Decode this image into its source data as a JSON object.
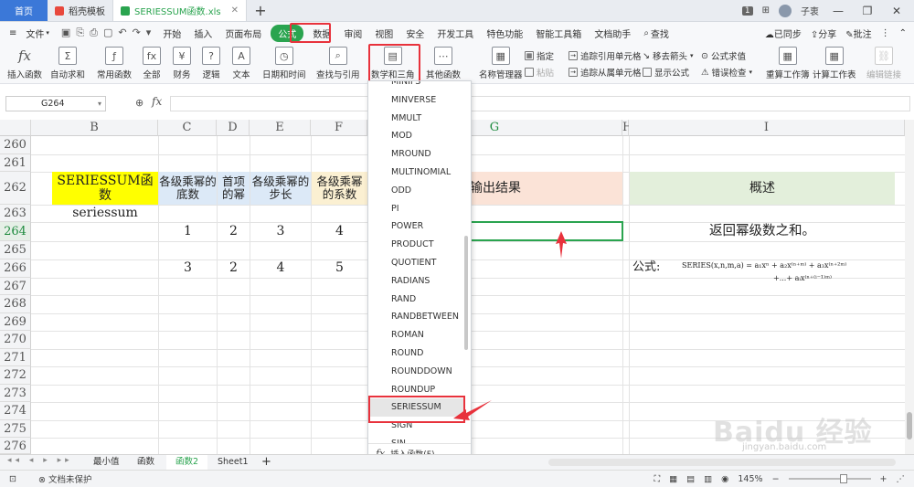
{
  "titlebar": {
    "home_tab": "首页",
    "template_tab": "稻壳模板",
    "file_tab": "SERIESSUM函数.xls",
    "page_badge": "1",
    "username": "子衷"
  },
  "menubar": {
    "file": "文件",
    "items": [
      "开始",
      "插入",
      "页面布局",
      "公式",
      "数据",
      "审阅",
      "视图",
      "安全",
      "开发工具",
      "特色功能",
      "智能工具箱",
      "文档助手"
    ],
    "search": "查找",
    "synced": "已同步",
    "share": "分享",
    "annotate": "批注"
  },
  "ribbon": {
    "insert_function": "插入函数",
    "autosum": "自动求和",
    "common_functions": "常用函数",
    "all": "全部",
    "financial": "财务",
    "logical": "逻辑",
    "text": "文本",
    "datetime": "日期和时间",
    "lookup": "查找与引用",
    "math_trig": "数学和三角",
    "other_functions": "其他函数",
    "name_manager": "名称管理器",
    "specify": "指定",
    "paste": "粘贴",
    "trace_precedents": "追踪引用单元格",
    "trace_dependents": "追踪从属单元格",
    "remove_arrows": "移去箭头",
    "show_formulas": "显示公式",
    "evaluate_formula": "公式求值",
    "error_checking": "错误检查",
    "recalc_sheet": "重算工作簿",
    "calc_sheet": "计算工作表",
    "edit_links": "编辑链接"
  },
  "formula_bar": {
    "name_box": "G264",
    "fx": "fx",
    "value": ""
  },
  "grid": {
    "columns": [
      "B",
      "C",
      "D",
      "E",
      "F",
      "G",
      "H",
      "I"
    ],
    "rows": [
      "260",
      "261",
      "262",
      "263",
      "264",
      "265",
      "266",
      "267",
      "268",
      "269",
      "270",
      "271",
      "272",
      "273",
      "274",
      "275",
      "276"
    ],
    "header_b": "SERIESSUM函数",
    "header_c": "各级乘幂的底数",
    "header_d": "首项的幂",
    "header_e": "各级乘幂的步长",
    "header_f": "各级乘幂的系数",
    "header_g": "输出结果",
    "header_i": "概述",
    "b263": "seriessum",
    "row264": [
      "1",
      "2",
      "3",
      "4"
    ],
    "row266": [
      "3",
      "2",
      "4",
      "5"
    ],
    "i264": "返回幂级数之和。",
    "i266_label": "公式:",
    "formula_line1": "SERIES(x,n,m,a) = a₁xⁿ + a₂x⁽ⁿ⁺ᵐ⁾ + a₃x⁽ⁿ⁺²ᵐ⁾",
    "formula_line2": "+...+ aᵢx⁽ⁿ⁺⁽ⁱ⁻¹⁾ᵐ⁾"
  },
  "dropdown": {
    "items": [
      "MINIFS",
      "MINVERSE",
      "MMULT",
      "MOD",
      "MROUND",
      "MULTINOMIAL",
      "ODD",
      "PI",
      "POWER",
      "PRODUCT",
      "QUOTIENT",
      "RADIANS",
      "RAND",
      "RANDBETWEEN",
      "ROMAN",
      "ROUND",
      "ROUNDDOWN",
      "ROUNDUP",
      "SERIESSUM",
      "SIGN",
      "SIN"
    ],
    "highlighted": "SERIESSUM",
    "footer": "插入函数(F)..."
  },
  "sheets": {
    "tabs": [
      "最小值",
      "函数",
      "函数2",
      "Sheet1"
    ],
    "active": "函数2"
  },
  "statusbar": {
    "protect": "文档未保护",
    "zoom": "145%"
  },
  "watermark": {
    "brand": "Baidu 经验",
    "url": "jingyan.baidu.com"
  },
  "colors": {
    "accent_green": "#2aa44f",
    "highlight_red": "#e8323c",
    "home_blue": "#3b78d8"
  }
}
